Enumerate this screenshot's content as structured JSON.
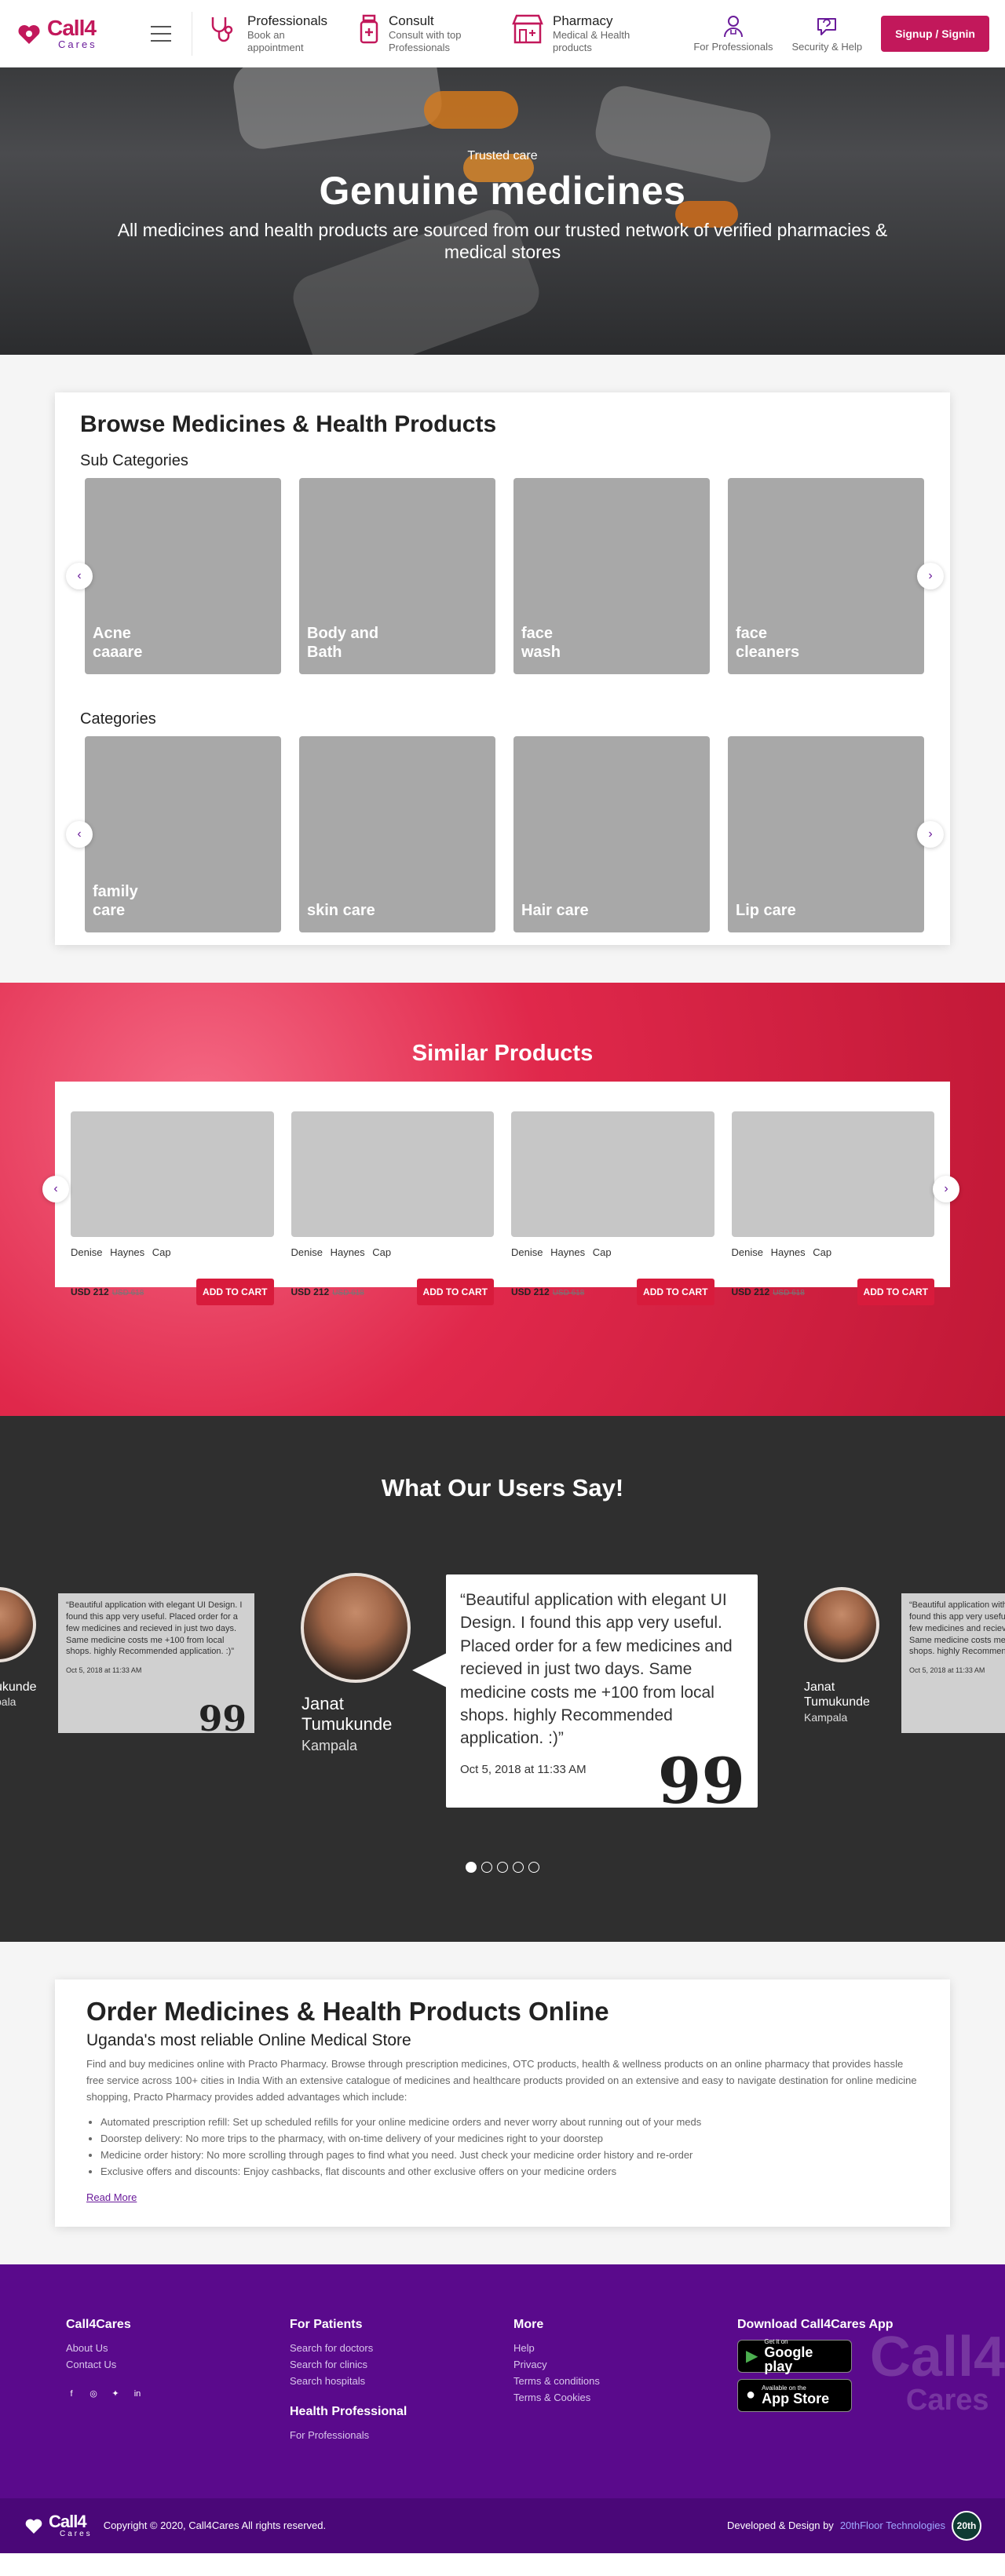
{
  "header": {
    "logo_main": "Call4",
    "logo_sub": "Cares",
    "nav": [
      {
        "title": "Professionals",
        "sub": "Book an appointment"
      },
      {
        "title": "Consult",
        "sub": "Consult with top Professionals"
      },
      {
        "title": "Pharmacy",
        "sub": "Medical & Health products"
      }
    ],
    "for_professionals": "For Professionals",
    "security_help": "Security & Help",
    "signup_label": "Signup / Signin"
  },
  "hero": {
    "eyebrow": "Trusted care",
    "title": "Genuine medicines",
    "subtitle": "All medicines and health products are sourced from our trusted network of verified pharmacies & medical stores"
  },
  "browse": {
    "title": "Browse Medicines & Health Products",
    "sub_categories_label": "Sub Categories",
    "sub_categories": [
      "Acne\ncaaare",
      "Body and\nBath",
      "face\nwash",
      "face\ncleaners"
    ],
    "categories_label": "Categories",
    "categories": [
      "family\ncare",
      "skin care",
      "Hair care",
      "Lip care"
    ]
  },
  "similar": {
    "title": "Similar Products",
    "products": [
      {
        "name": "Denise Haynes Cap",
        "price": "USD 212",
        "old_price": "USD 618",
        "cta": "ADD TO CART"
      },
      {
        "name": "Denise Haynes Cap",
        "price": "USD 212",
        "old_price": "USD 618",
        "cta": "ADD TO CART"
      },
      {
        "name": "Denise Haynes Cap",
        "price": "USD 212",
        "old_price": "USD 618",
        "cta": "ADD TO CART"
      },
      {
        "name": "Denise Haynes Cap",
        "price": "USD 212",
        "old_price": "USD 618",
        "cta": "ADD TO CART"
      }
    ]
  },
  "testimonials": {
    "title": "What Our Users Say!",
    "quote": "“Beautiful application with elegant UI Design. I found this app very useful. Placed order for a few medicines and recieved in just two days. Same medicine costs me +100 from local shops. highly Recommended application. :)”",
    "date": "Oct 5, 2018 at 11:33 AM",
    "name": "Janat Tumukunde",
    "city": "Kampala",
    "left_name_fragment": "ukunde",
    "left_city_fragment": "pala",
    "quote_mark": "99",
    "dots": 5,
    "active_dot": 0
  },
  "order": {
    "title": "Order Medicines & Health Products Online",
    "subtitle": "Uganda's most reliable Online Medical Store",
    "description": "Find and buy medicines online with Practo Pharmacy. Browse through prescription medicines, OTC products, health & wellness products on an online pharmacy that provides hassle free service across 100+ cities in India With an extensive catalogue of medicines and healthcare products provided on an extensive and easy to navigate destination for online medicine shopping, Practo Pharmacy provides added advantages which include:",
    "bullets": [
      "Automated prescription refill: Set up scheduled refills for your online medicine orders and never worry about running out of your meds",
      "Doorstep delivery: No more trips to the pharmacy, with on-time delivery of your medicines right to your doorstep",
      "Medicine order history: No more scrolling through pages to find what you need. Just check your medicine order history and re-order",
      "Exclusive offers and discounts: Enjoy cashbacks, flat discounts and other exclusive offers on your medicine orders"
    ],
    "read_more": "Read More"
  },
  "footer": {
    "col1": {
      "title": "Call4Cares",
      "links": [
        "About Us",
        "Contact Us"
      ]
    },
    "col2": {
      "title": "For Patients",
      "links": [
        "Search for doctors",
        "Search for clinics",
        "Search hospitals"
      ],
      "title2": "Health Professional",
      "links2": [
        "For Professionals"
      ]
    },
    "col3": {
      "title": "More",
      "links": [
        "Help",
        "Privacy",
        "Terms & conditions",
        "Terms & Cookies"
      ]
    },
    "col4": {
      "title": "Download Call4Cares App"
    },
    "google_small": "Get it on",
    "google_big": "Google play",
    "apple_small": "Available on the",
    "apple_big": "App Store",
    "watermark_main": "Call4",
    "watermark_sub": "Cares",
    "copyright": "Copyright © 2020, Call4Cares All rights reserved.",
    "developed": "Developed & Design by",
    "developer": "20thFloor Technologies",
    "badge": "20th"
  }
}
